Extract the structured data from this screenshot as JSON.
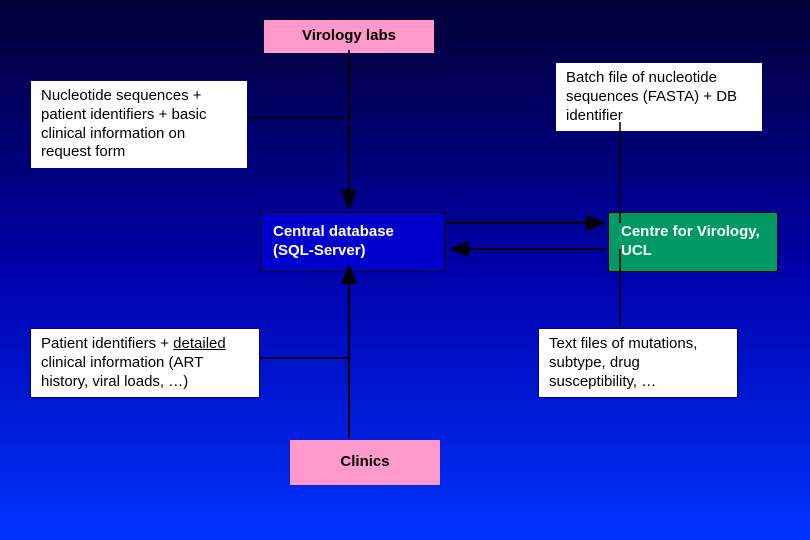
{
  "boxes": {
    "virology_labs": "Virology labs",
    "nucleotide_seq": "Nucleotide sequences + patient identifiers + basic clinical information on request form",
    "batch_file": "Batch file of nucleotide sequences (FASTA) + DB identifier",
    "central_db": "Central database (SQL-Server)",
    "centre_virology": "Centre for Virology, UCL",
    "patient_identifiers_pre": "Patient identifiers + ",
    "patient_identifiers_u": "detailed",
    "patient_identifiers_post": " clinical information (ART history, viral loads, …)",
    "text_files": "Text files of mutations, subtype, drug susceptibility, …",
    "clinics": "Clinics"
  },
  "colors": {
    "pink": "#FF99CC",
    "blue": "#0000CC",
    "green": "#009966",
    "arrow": "#000000"
  }
}
